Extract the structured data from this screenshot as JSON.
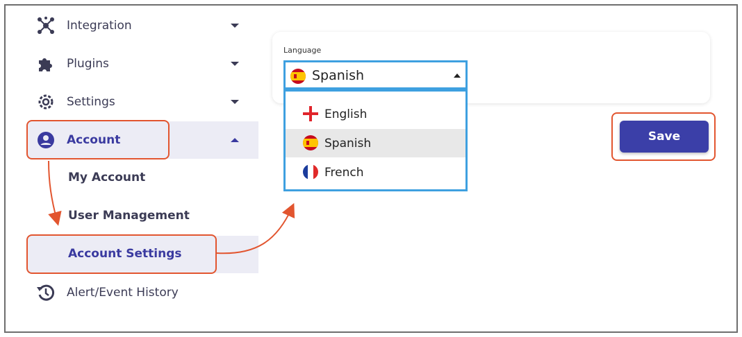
{
  "sidebar": {
    "items": [
      {
        "label": "Integration",
        "icon": "integration-icon"
      },
      {
        "label": "Plugins",
        "icon": "puzzle-icon"
      },
      {
        "label": "Settings",
        "icon": "gear-icon"
      },
      {
        "label": "Account",
        "icon": "account-icon"
      }
    ],
    "account_sub": [
      {
        "label": "My Account"
      },
      {
        "label": "User Management"
      },
      {
        "label": "Account Settings"
      }
    ],
    "history": {
      "label": "Alert/Event History",
      "icon": "history-icon"
    }
  },
  "language": {
    "label": "Language",
    "selected": "Spanish",
    "options": [
      "English",
      "Spanish",
      "French"
    ]
  },
  "actions": {
    "save_label": "Save"
  },
  "colors": {
    "accent": "#3b3fa8",
    "highlight": "#e2552f",
    "focus": "#3ea0e0"
  }
}
